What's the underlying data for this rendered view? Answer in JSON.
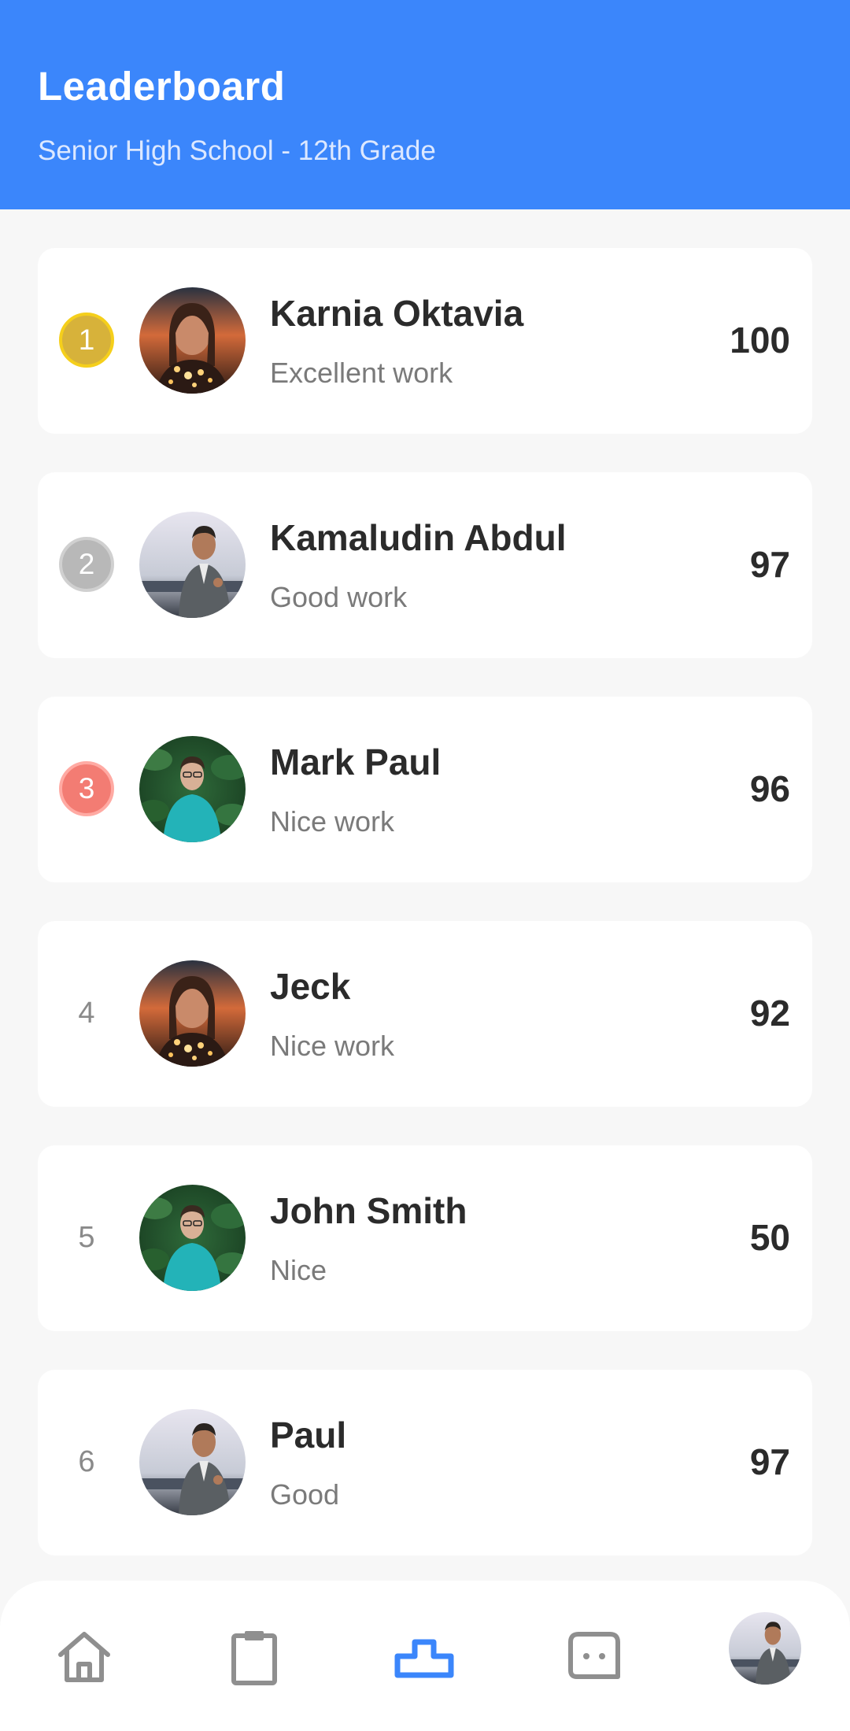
{
  "header": {
    "title": "Leaderboard",
    "subtitle": "Senior High School - 12th Grade"
  },
  "colors": {
    "primary": "#3b86fb",
    "gold": "#d7b23a",
    "silver": "#b8b8b8",
    "bronze": "#f37c73"
  },
  "entries": [
    {
      "rank": "1",
      "name": "Karnia Oktavia",
      "comment": "Excellent work",
      "score": "100",
      "badge": "gold",
      "avatar": "woman-lights"
    },
    {
      "rank": "2",
      "name": "Kamaludin Abdul",
      "comment": "Good work",
      "score": "97",
      "badge": "silver",
      "avatar": "man-suit"
    },
    {
      "rank": "3",
      "name": "Mark Paul",
      "comment": "Nice work",
      "score": "96",
      "badge": "bronze",
      "avatar": "man-teal-shirt"
    },
    {
      "rank": "4",
      "name": "Jeck",
      "comment": "Nice work",
      "score": "92",
      "badge": "none",
      "avatar": "woman-lights"
    },
    {
      "rank": "5",
      "name": "John Smith",
      "comment": "Nice",
      "score": "50",
      "badge": "none",
      "avatar": "man-teal-shirt"
    },
    {
      "rank": "6",
      "name": "Paul",
      "comment": "Good",
      "score": "97",
      "badge": "none",
      "avatar": "man-suit"
    }
  ],
  "nav": {
    "items": [
      {
        "icon": "home-icon",
        "active": false
      },
      {
        "icon": "clipboard-icon",
        "active": false
      },
      {
        "icon": "podium-icon",
        "active": true
      },
      {
        "icon": "chat-icon",
        "active": false
      },
      {
        "icon": "profile-avatar",
        "active": false
      }
    ]
  }
}
